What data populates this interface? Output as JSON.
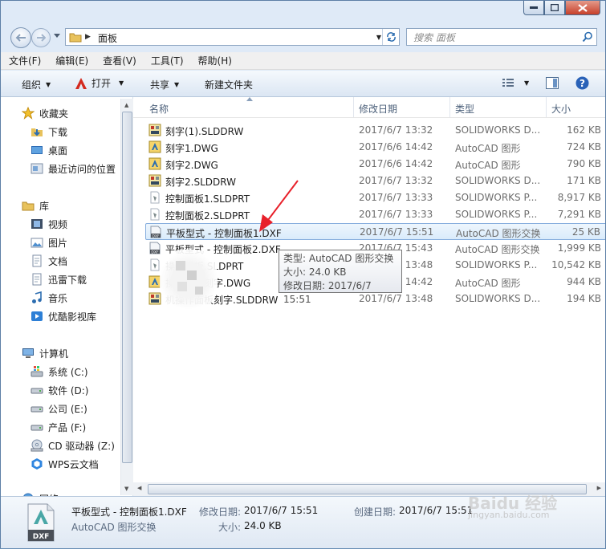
{
  "search": {
    "placeholder": "搜索 面板"
  },
  "address": {
    "path": "面板"
  },
  "menu": [
    "文件(F)",
    "编辑(E)",
    "查看(V)",
    "工具(T)",
    "帮助(H)"
  ],
  "toolbar": {
    "organize": "组织",
    "open": "打开",
    "share": "共享",
    "new_folder": "新建文件夹"
  },
  "nav": {
    "favorites": "收藏夹",
    "fav_items": [
      "下载",
      "桌面",
      "最近访问的位置"
    ],
    "libraries": "库",
    "lib_items": [
      "视频",
      "图片",
      "文档",
      "迅雷下载",
      "音乐",
      "优酷影视库"
    ],
    "computer": "计算机",
    "drives": [
      "系统 (C:)",
      "软件 (D:)",
      "公司 (E:)",
      "产品 (F:)",
      "CD 驱动器 (Z:)",
      "WPS云文档"
    ],
    "network": "网络"
  },
  "columns": {
    "name": "名称",
    "date": "修改日期",
    "type": "类型",
    "size": "大小"
  },
  "files": [
    {
      "name": "刻字(1).SLDDRW",
      "date": "2017/6/7 13:32",
      "type": "SOLIDWORKS D...",
      "size": "162 KB",
      "icon": "sldrw-icon"
    },
    {
      "name": "刻字1.DWG",
      "date": "2017/6/6 14:42",
      "type": "AutoCAD 图形",
      "size": "724 KB",
      "icon": "dwg-icon"
    },
    {
      "name": "刻字2.DWG",
      "date": "2017/6/6 14:42",
      "type": "AutoCAD 图形",
      "size": "790 KB",
      "icon": "dwg-icon"
    },
    {
      "name": "刻字2.SLDDRW",
      "date": "2017/6/7 13:32",
      "type": "SOLIDWORKS D...",
      "size": "171 KB",
      "icon": "sldrw-icon"
    },
    {
      "name": "控制面板1.SLDPRT",
      "date": "2017/6/7 13:33",
      "type": "SOLIDWORKS P...",
      "size": "8,917 KB",
      "icon": "sldprt-icon"
    },
    {
      "name": "控制面板2.SLDPRT",
      "date": "2017/6/7 13:33",
      "type": "SOLIDWORKS P...",
      "size": "7,291 KB",
      "icon": "sldprt-icon"
    },
    {
      "name": "平板型式 - 控制面板1.DXF",
      "date": "2017/6/7 15:51",
      "type": "AutoCAD 图形交换",
      "size": "25 KB",
      "icon": "dxf-icon"
    },
    {
      "name": "平板型式 - 控制面板2.DXF",
      "date": "2017/6/7 15:43",
      "type": "AutoCAD 图形交换",
      "size": "1,999 KB",
      "icon": "dxf-icon"
    },
    {
      "name": "操作面板.SLDPRT",
      "date": "2017/6/7 13:48",
      "type": "SOLIDWORKS P...",
      "size": "10,542 KB",
      "icon": "sldprt-icon"
    },
    {
      "name": "操作面板刻字.DWG",
      "date": "2017/6/6 14:42",
      "type": "AutoCAD 图形",
      "size": "944 KB",
      "icon": "dwg-icon"
    },
    {
      "name": "机操作面板刻字.SLDDRW",
      "date": "2017/6/7 13:48",
      "type": "SOLIDWORKS D...",
      "size": "194 KB",
      "icon": "sldrw-icon"
    }
  ],
  "selected_index": 6,
  "tooltip": {
    "type": "类型: AutoCAD 图形交换",
    "size": "大小: 24.0 KB",
    "modified": "修改日期: 2017/6/7 15:51"
  },
  "details": {
    "name": "平板型式 - 控制面板1.DXF",
    "type": "AutoCAD 图形交换",
    "modified_label": "修改日期:",
    "modified": "2017/6/7 15:51",
    "size_label": "大小:",
    "size": "24.0 KB",
    "created_label": "创建日期:",
    "created": "2017/6/7 15:51",
    "icon_text": "DXF"
  },
  "watermark": {
    "brand": "Baidu 经验",
    "url": "jingyan.baidu.com"
  },
  "colors": {
    "accent": "#2c6db0",
    "selection": "#d9ebfb",
    "red_arrow": "#e8202a"
  }
}
